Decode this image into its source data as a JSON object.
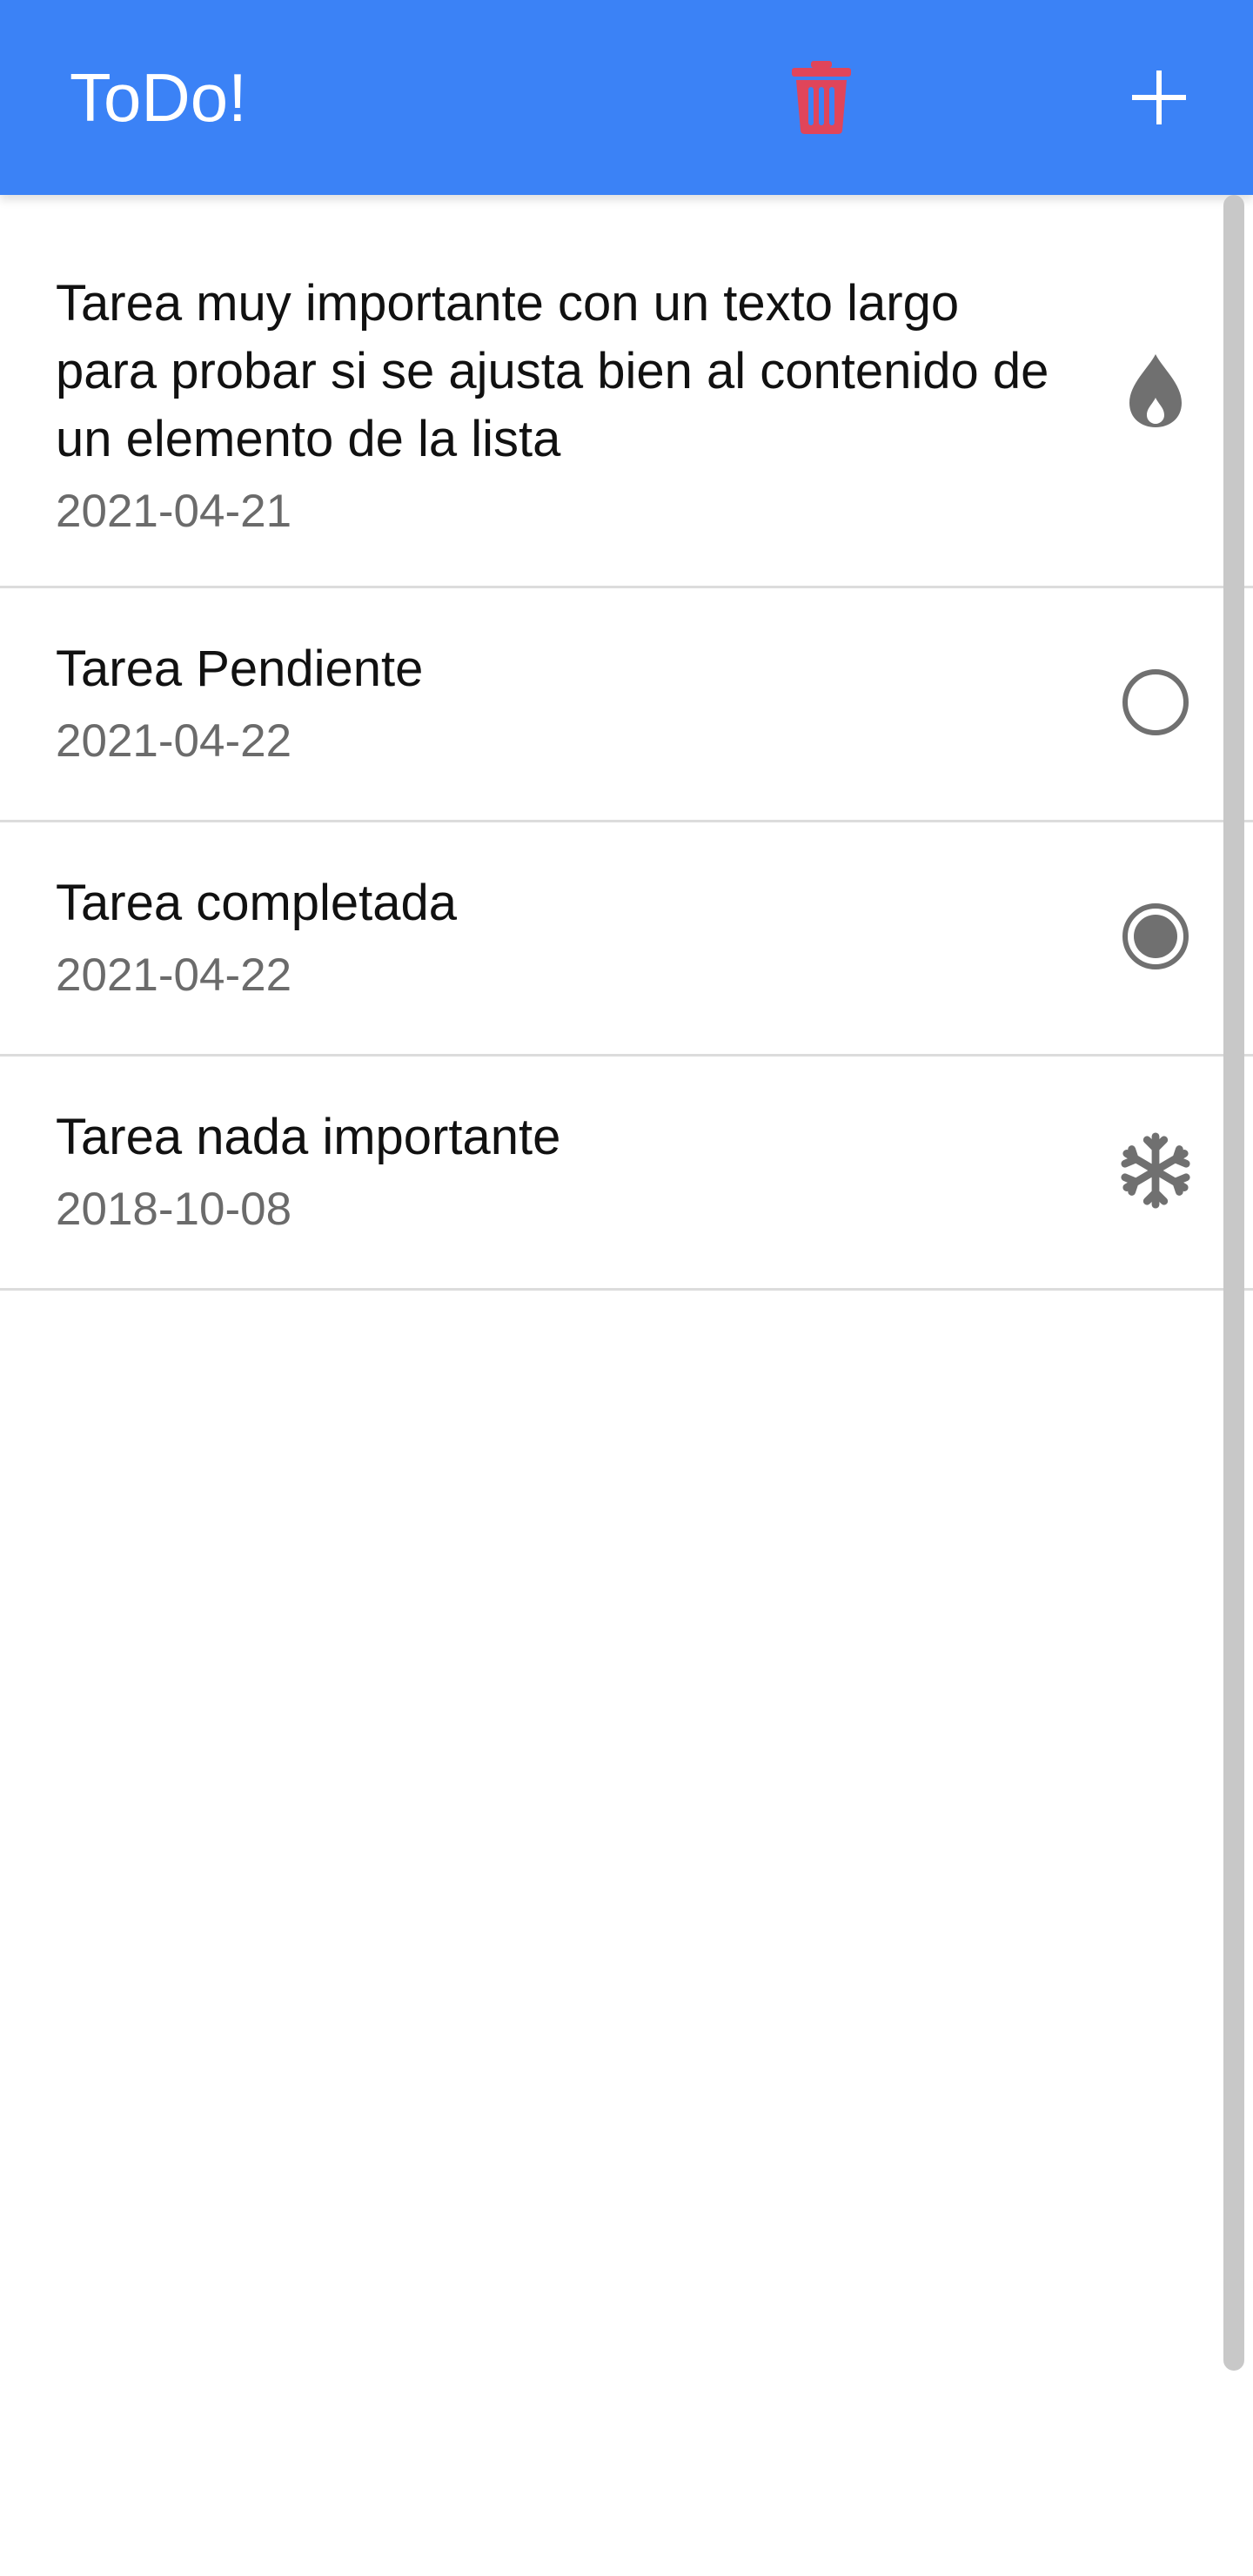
{
  "header": {
    "title": "ToDo!",
    "delete_icon": "trash-icon",
    "add_icon": "plus-icon",
    "colors": {
      "bar": "#3b82f6",
      "delete": "#e0455a",
      "text": "#ffffff"
    }
  },
  "tasks": [
    {
      "title": "Tarea muy importante con un texto largo para probar si se ajusta bien al contenido de un elemento de la lista",
      "date": "2021-04-21",
      "icon": "flame-icon"
    },
    {
      "title": "Tarea Pendiente",
      "date": "2021-04-22",
      "icon": "radio-unchecked-icon"
    },
    {
      "title": "Tarea completada",
      "date": "2021-04-22",
      "icon": "radio-checked-icon"
    },
    {
      "title": "Tarea nada importante",
      "date": "2018-10-08",
      "icon": "snowflake-icon"
    }
  ]
}
